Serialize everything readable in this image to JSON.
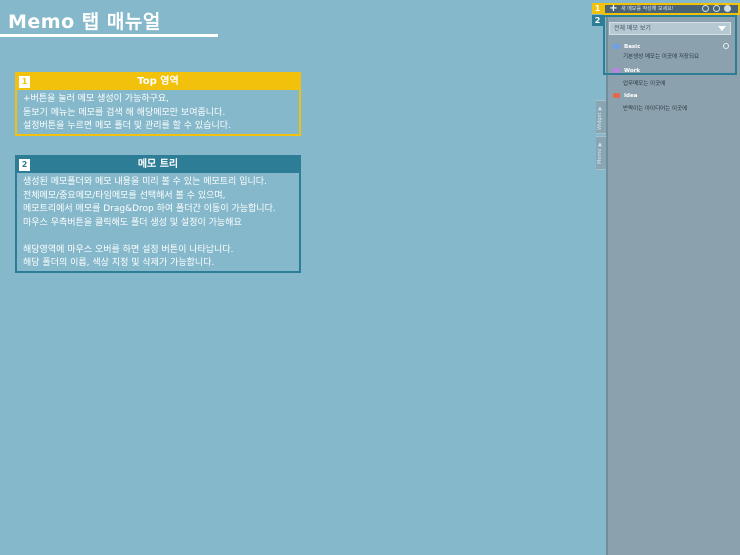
{
  "page": {
    "title": "Memo 탭 매뉴얼"
  },
  "callouts": {
    "top": {
      "number": "1",
      "heading": "Top 영역",
      "lines": [
        "+버튼을 눌러 메모 생성이 가능하구요,",
        "돋보기 메뉴는 메모를 검색 해 해당메모만 보여줍니다.",
        "설정버튼을 누르면 메모 폴더 및 관리를 할 수 있습니다."
      ]
    },
    "tree": {
      "number": "2",
      "heading": "메모 트리",
      "lines": [
        "생성된 메모폴더와 메모 내용을 미리 볼 수 있는 메모트리 입니다.",
        "전체메모/중요메모/타임메모를 선택해서 볼 수 있으며,",
        "메모트리에서 메모를 Drag&Drop 하여 폴더간 이동이 가능합니다.",
        "마우스 우측버튼을 클릭해도 폴더 생성 및 설정이 가능해요",
        "",
        "해당영역에 마우스 오버를 하면 설정 버튼이 나타납니다.",
        "해당 폴더의 이름, 색상 지정 및 삭제가 가능합니다."
      ]
    }
  },
  "panel": {
    "badges": [
      "1",
      "2"
    ],
    "quick_memo_placeholder": "새 메모를 작성해 보세요!",
    "plus_label": "+",
    "dropdown_value": "전체 메모 보기",
    "side_tabs": [
      "Widget ▼",
      "Memo ▼"
    ],
    "tree": [
      {
        "folder": "Basic",
        "color": "#6fa0e8",
        "memo": "기본생성 메모는 이곳에 저장되요"
      },
      {
        "folder": "Work",
        "color": "#b784e0",
        "memo": "업무메모는 이곳에"
      },
      {
        "folder": "Idea",
        "color": "#e8664a",
        "memo": "반짝이는 아이디어는 이곳에"
      }
    ]
  },
  "colors": {
    "background": "#84b8ca",
    "top_accent": "#f2c10b",
    "tree_accent": "#2e7d97",
    "panel": "#8ba2ae"
  }
}
